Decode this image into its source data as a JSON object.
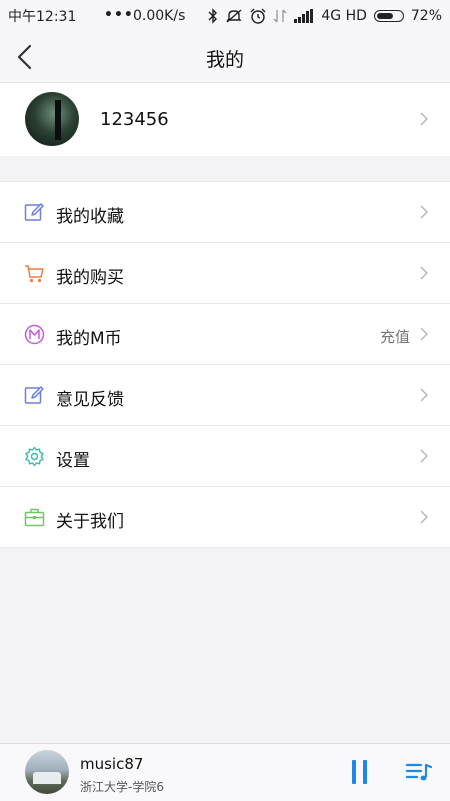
{
  "status": {
    "time": "中午12:31",
    "dots": "•••",
    "speed": "0.00K/s",
    "network": "4G HD",
    "battery": "72%",
    "battery_level": 0.72
  },
  "header": {
    "title": "我的"
  },
  "profile": {
    "username": "123456"
  },
  "menu": [
    {
      "label": "我的收藏",
      "icon": "edit-icon",
      "color": "#6d7fdb"
    },
    {
      "label": "我的购买",
      "icon": "cart-icon",
      "color": "#ef7d4a"
    },
    {
      "label": "我的M币",
      "icon": "m-coin-icon",
      "color": "#c55bd8",
      "extra": "充值"
    },
    {
      "label": "意见反馈",
      "icon": "feedback-icon",
      "color": "#6d7fdb"
    },
    {
      "label": "设置",
      "icon": "gear-icon",
      "color": "#37b9b1"
    },
    {
      "label": "关于我们",
      "icon": "briefcase-icon",
      "color": "#72c56a"
    }
  ],
  "player": {
    "song": "music87",
    "artist": "浙江大学-学院6",
    "accent": "#1e88e5"
  }
}
